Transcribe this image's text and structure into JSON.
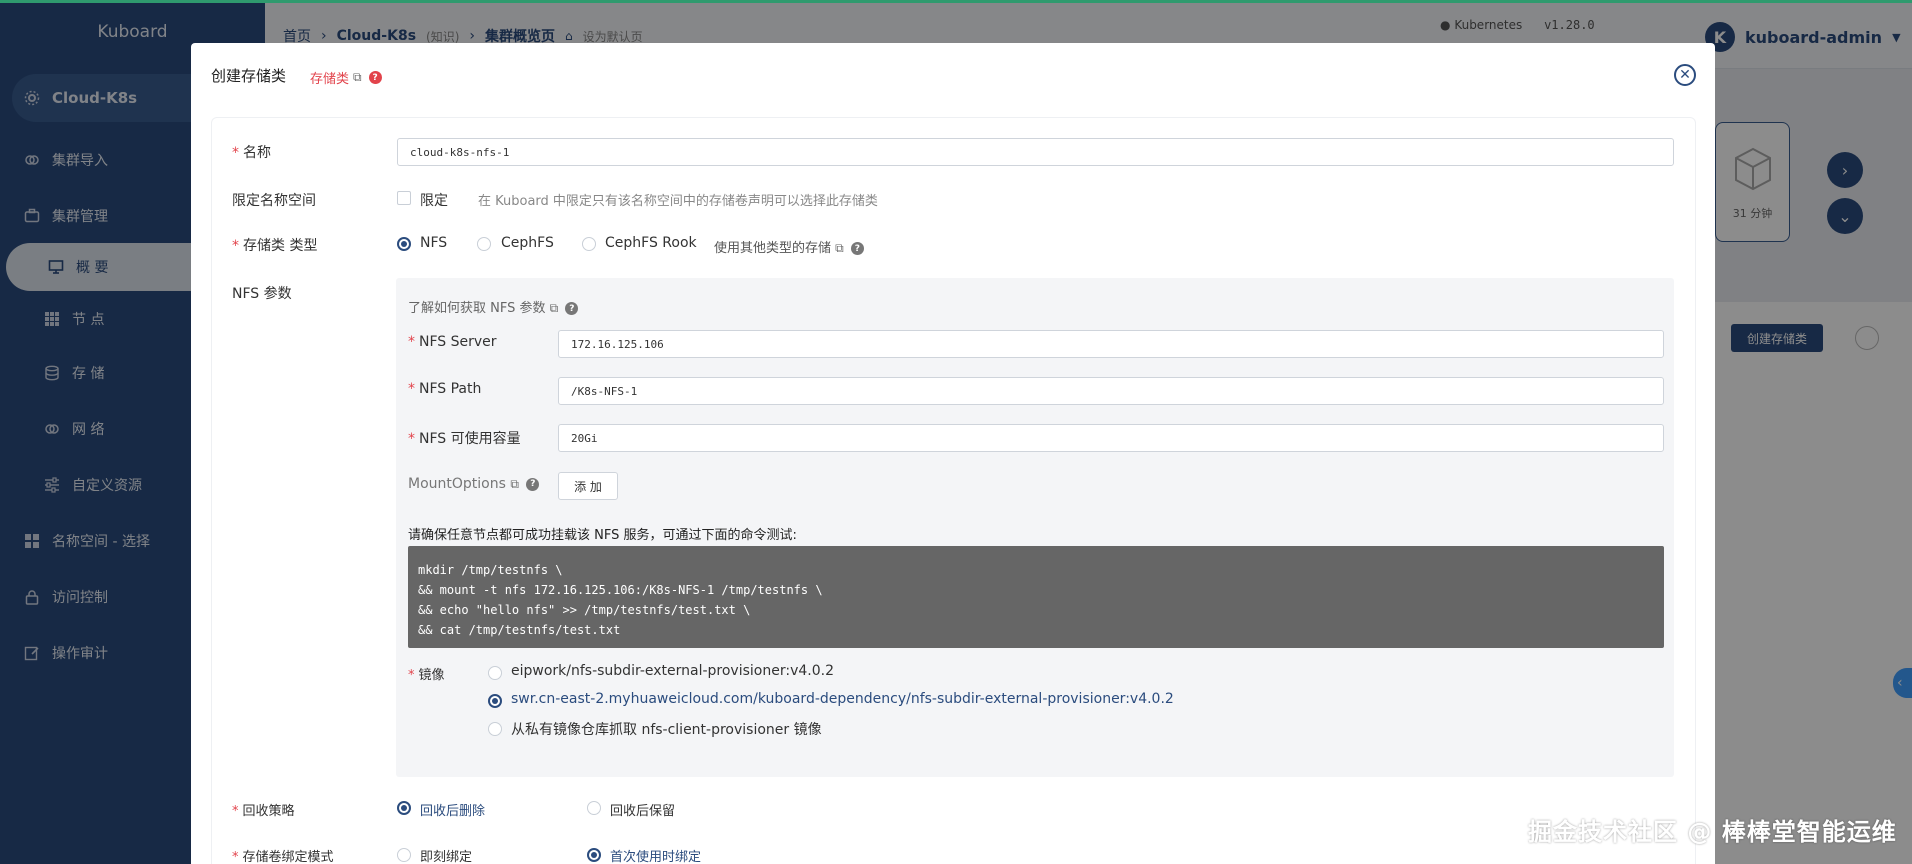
{
  "sidebar": {
    "brand": "Kuboard",
    "cluster": "Cloud-K8s",
    "items": [
      {
        "label": "集群导入"
      },
      {
        "label": "集群管理"
      },
      {
        "label": "概 要"
      },
      {
        "label": "节 点"
      },
      {
        "label": "存 储"
      },
      {
        "label": "网 络"
      },
      {
        "label": "自定义资源"
      },
      {
        "label": "名称空间 - 选择"
      },
      {
        "label": "访问控制"
      },
      {
        "label": "操作审计"
      }
    ]
  },
  "topbar": {
    "crumb_home": "首页",
    "crumb_cluster": "Cloud-K8s",
    "crumb_tag": "(知识)",
    "crumb_page": "集群概览页",
    "set_default": "设为默认页",
    "k8s_label": "Kubernetes",
    "k8s_version": "v1.28.0",
    "avatar_letter": "K",
    "user": "kuboard-admin"
  },
  "background": {
    "card_text": "31 分钟",
    "create_button": "创建存储类"
  },
  "dialog": {
    "title": "创建存储类",
    "tag": "存储类",
    "name_label": "名称",
    "name_value": "cloud-k8s-nfs-1",
    "ns_label": "限定名称空间",
    "ns_check_label": "限定",
    "ns_hint": "在 Kuboard 中限定只有该名称空间中的存储卷声明可以选择此存储类",
    "type_label": "存储类 类型",
    "type_options": [
      "NFS",
      "CephFS",
      "CephFS Rook"
    ],
    "other_type_link": "使用其他类型的存储",
    "nfs_params_label": "NFS 参数",
    "nfs_help": "了解如何获取 NFS 参数",
    "nfs_server_label": "NFS Server",
    "nfs_server_value": "172.16.125.106",
    "nfs_path_label": "NFS Path",
    "nfs_path_value": "/K8s-NFS-1",
    "nfs_cap_label": "NFS 可使用容量",
    "nfs_cap_value": "20Gi",
    "mount_label": "MountOptions",
    "add_button": "添 加",
    "cmd_title": "请确保任意节点都可成功挂载该 NFS 服务，可通过下面的命令测试:",
    "cmd_lines": [
      "mkdir /tmp/testnfs \\",
      "&& mount -t nfs 172.16.125.106:/K8s-NFS-1 /tmp/testnfs \\",
      "&& echo \"hello nfs\" >> /tmp/testnfs/test.txt \\",
      "&& cat /tmp/testnfs/test.txt"
    ],
    "image_label": "镜像",
    "image_options": [
      "eipwork/nfs-subdir-external-provisioner:v4.0.2",
      "swr.cn-east-2.myhuaweicloud.com/kuboard-dependency/nfs-subdir-external-provisioner:v4.0.2",
      "从私有镜像仓库抓取 nfs-client-provisioner 镜像"
    ],
    "reclaim_label": "回收策略",
    "reclaim_options": [
      "回收后删除",
      "回收后保留"
    ],
    "binding_label": "存储卷绑定模式",
    "binding_options": [
      "即刻绑定",
      "首次使用时绑定"
    ]
  },
  "watermark": "掘金技术社区 @ 棒棒堂智能运维",
  "colors": {
    "sidebar": "#2b4c7e",
    "accent": "#2b4c7e",
    "required": "#e2434b"
  }
}
